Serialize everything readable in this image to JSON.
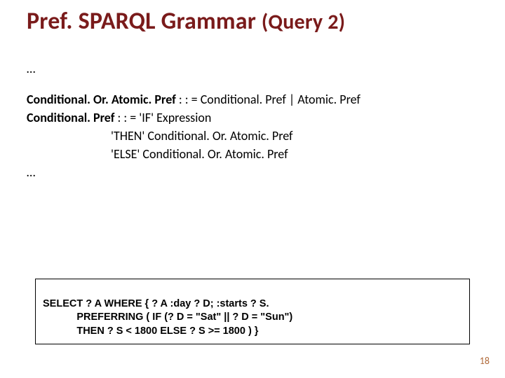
{
  "title": {
    "main": "Pref. SPARQL Grammar ",
    "sub": "(Query 2)"
  },
  "grammar": {
    "ell1": "…",
    "rule1_lhs": "Conditional. Or. Atomic. Pref ",
    "rule1_rhs": ": : = Conditional. Pref | Atomic. Pref",
    "rule2_lhs": "Conditional. Pref ",
    "rule2_rhs": ": : = 'IF' Expression",
    "rule2_line2": "'THEN' Conditional. Or. Atomic. Pref",
    "rule2_line3": "'ELSE' Conditional. Or. Atomic. Pref",
    "ell2": "…"
  },
  "code": {
    "line1": "SELECT ? A WHERE { ? A :day ? D; :starts ? S.",
    "line2": "            PREFERRING ( IF (? D = \"Sat\" || ? D = \"Sun\")",
    "line3": "            THEN ? S < 1800 ELSE ? S >= 1800 ) }"
  },
  "page_number": "18"
}
